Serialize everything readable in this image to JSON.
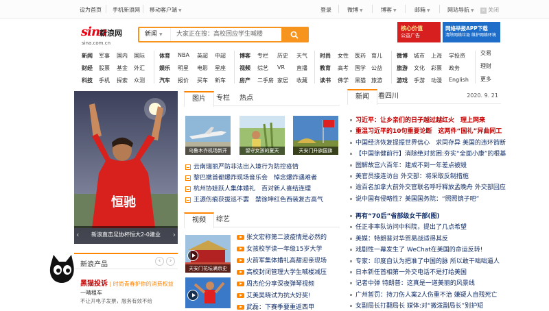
{
  "topbar": {
    "left": [
      "设为首页",
      "手机新浪网",
      "移动客户端"
    ],
    "right": [
      "登录",
      "微博",
      "博客",
      "邮箱",
      "网站导航"
    ],
    "close": "关闭"
  },
  "logo": {
    "brand": "sina",
    "cn": "新浪网",
    "domain": "sina.com.cn"
  },
  "search": {
    "category": "新闻",
    "placeholder": "大家正在搜：高校回应学生喊楼"
  },
  "ads": {
    "ad1": "核心价值",
    "ad1_sub": "公益广告",
    "ad2": "网络举报APP下载",
    "ad2_sub": "清除网络垃圾 维护网络环境"
  },
  "nav": {
    "g1": [
      [
        "新闻",
        "军事",
        "国内",
        "国际"
      ],
      [
        "财经",
        "股票",
        "基金",
        "外汇"
      ],
      [
        "科技",
        "手机",
        "探索",
        "众测"
      ]
    ],
    "g2": [
      [
        "体育",
        "NBA",
        "英超",
        "中超"
      ],
      [
        "娱乐",
        "明星",
        "电影",
        "星座"
      ],
      [
        "汽车",
        "报价",
        "买车",
        "新车"
      ]
    ],
    "g3": [
      [
        "博客",
        "专栏",
        "历史",
        "天气"
      ],
      [
        "视频",
        "综艺",
        "VR",
        "直播"
      ],
      [
        "房产",
        "二手房",
        "家居",
        "收藏"
      ]
    ],
    "g4": [
      [
        "时尚",
        "女性",
        "医药",
        "育儿"
      ],
      [
        "教育",
        "高考",
        "国学",
        "公益"
      ],
      [
        "读书",
        "佛学",
        "黑猫",
        "旅游"
      ]
    ],
    "g5": [
      [
        "微博",
        "城市",
        "上海",
        "学投资"
      ],
      [
        "旅游",
        "文化",
        "彩票",
        "政务"
      ],
      [
        "游戏",
        "手游",
        "动漫",
        "English"
      ]
    ],
    "g6": [
      "交易",
      "理财",
      "更多"
    ]
  },
  "hero": {
    "caption": "新浪直击足协杯恒大2-0建业",
    "jersey": "恒驰"
  },
  "mid": {
    "tabs": [
      "图片",
      "专栏",
      "热点"
    ],
    "pics": [
      "乌鲁木齐机场新开",
      "留守女孩的夏天",
      "天安门升旗国旗"
    ],
    "news": [
      "云南瑞丽严防非法出入境行为防控疫情",
      "黎巴嫩首都爆炸现场音乐会　悼念爆炸遇难者",
      "杭州协娃跃人集体婚礼　百对新人喜结连理",
      "王源伤痕获拔巡不罢　禁徐坤红色西装复古高气"
    ],
    "video_tabs": [
      "视频",
      "综艺"
    ],
    "videos": [
      "张文宏称第二波疫情是必然的",
      "女孩校学读一年级15岁大学",
      "火箭军集体婚礼高甜迎亲现场",
      "高校封闭管理大学生喊楼减压",
      "周杰伦分享深夜弹琴视频",
      "艾美吴晓试为抗大好奖!",
      "武磊：下赛季要重返西甲"
    ],
    "video_thumbs": [
      "天安门花坛满京史",
      ""
    ]
  },
  "products": {
    "title": "新浪产品",
    "name": "黑猫投诉",
    "slogan": "时尚青春护你的消费权益",
    "line2": "一晴租车",
    "line3": "不让开电子发票，服务有效不给"
  },
  "right": {
    "tabs": [
      "新闻",
      "看四川"
    ],
    "date": "2020. 9. 21",
    "items": [
      "习近平：让乡亲们的日子越过越红火　理上网来",
      "重温习近平的10句重要论断　这两件“国礼”异曲同工",
      "中国经济恢复提振世界信心　求同存异 美国的违环箭断",
      "【中国徐健前行】消除绝对贫困:夯实“全面小康”的根基",
      "图解故宫六百年：建成不到一年差点被毁",
      "美官员接连访台 外交部：将采取反制措施",
      "逾百名加拿大前外交官联名呼吁释放孟晚舟 外交部回应",
      "说中国有侵略性？美国国务院：“照照镜子吧”",
      "再有“70后”省部级女干部(图)",
      "任正非率队访问中科院，提出了几点希望",
      "美媒：特朗普对华贸易战适得其反",
      "戏剧性一幕发生了 WeChat在美国的命运反转!",
      "专家：印度自认为把准了中国的脉 所以敢干咄咄逼人",
      "日本新任首相第一外交电话不是打给美国",
      "记者中弹 特朗普：这真是一道美丽的风景线",
      "广州暂罚：持刀伤人案2人伤重不治 嫌疑人自残死亡",
      "女副局长打翻局长 媒体:对“撒泼副局长”别护短"
    ]
  }
}
